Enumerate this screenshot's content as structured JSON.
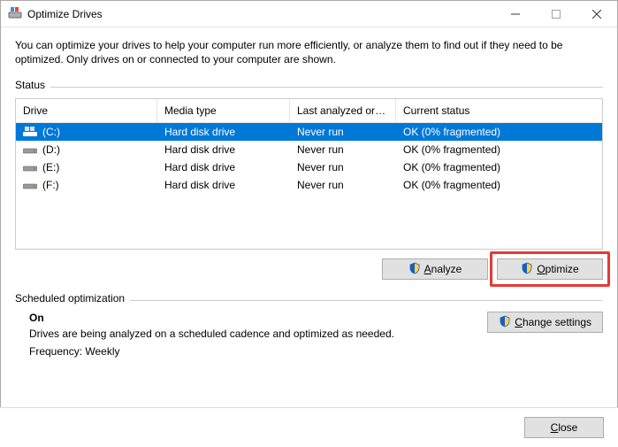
{
  "window": {
    "title": "Optimize Drives"
  },
  "description": "You can optimize your drives to help your computer run more efficiently, or analyze them to find out if they need to be optimized. Only drives on or connected to your computer are shown.",
  "status_label": "Status",
  "columns": {
    "drive": "Drive",
    "media": "Media type",
    "last": "Last analyzed or o...",
    "status": "Current status"
  },
  "drives": [
    {
      "name": "(C:)",
      "media": "Hard disk drive",
      "last": "Never run",
      "status": "OK (0% fragmented)",
      "selected": true,
      "icon": "os"
    },
    {
      "name": "(D:)",
      "media": "Hard disk drive",
      "last": "Never run",
      "status": "OK (0% fragmented)",
      "selected": false,
      "icon": "hdd"
    },
    {
      "name": "(E:)",
      "media": "Hard disk drive",
      "last": "Never run",
      "status": "OK (0% fragmented)",
      "selected": false,
      "icon": "hdd"
    },
    {
      "name": "(F:)",
      "media": "Hard disk drive",
      "last": "Never run",
      "status": "OK (0% fragmented)",
      "selected": false,
      "icon": "hdd"
    }
  ],
  "buttons": {
    "analyze_prefix": "A",
    "analyze_rest": "nalyze",
    "optimize_prefix": "O",
    "optimize_rest": "ptimize",
    "change_settings_prefix": "C",
    "change_settings_rest": "hange settings",
    "close_prefix": "C",
    "close_rest": "lose"
  },
  "scheduled": {
    "label": "Scheduled optimization",
    "state": "On",
    "desc": "Drives are being analyzed on a scheduled cadence and optimized as needed.",
    "freq": "Frequency: Weekly"
  }
}
